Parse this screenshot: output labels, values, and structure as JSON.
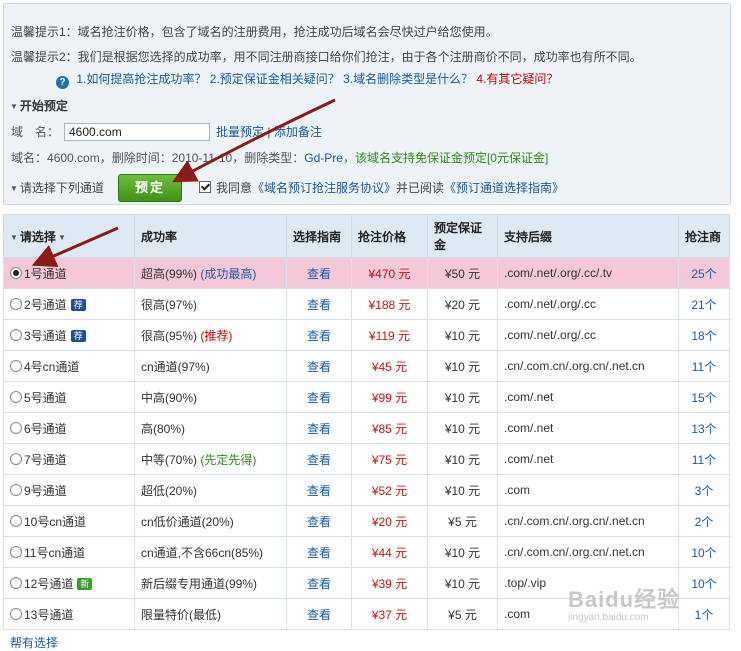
{
  "tips": {
    "tip1": "温馨提示1：域名抢注价格，包含了域名的注册费用，抢注成功后域名会尽快过户给您使用。",
    "tip2": "温馨提示2：我们是根据您选择的成功率，用不同注册商接口给你们抢注，由于各个注册商价不同，成功率也有所不同。"
  },
  "faq": {
    "q1": "1.如何提高抢注成功率？",
    "q2": "2.预定保证金相关疑问？",
    "q3": "3.域名删除类型是什么？",
    "q4": "4.有其它疑问？"
  },
  "booking": {
    "section_title": "开始预定",
    "domain_label": "域　名：",
    "domain_value": "4600.com",
    "batch_link": "批量预定",
    "separator": "|",
    "note_link": "添加备注",
    "info_prefix": "域名：",
    "info_domain": "4600.com",
    "info_delete_label": "，删除时间：",
    "info_delete_time": "2010-11-10",
    "info_type_label": "，删除类型：",
    "info_type": "Gd-Pre",
    "info_free": "，该域名支持免保证金预定[0元保证金]",
    "channel_label": "请选择下列通道",
    "book_button": "预定",
    "agree_prefix": "我同意",
    "agree_link1": "《域名预订抢注服务协议》",
    "agree_mid": "并已阅读",
    "agree_link2": "《预订通道选择指南》"
  },
  "table": {
    "headers": [
      "请选择",
      "成功率",
      "选择指南",
      "抢注价格",
      "预定保证金",
      "支持后缀",
      "抢注商"
    ],
    "rows": [
      {
        "name": "1号通道",
        "badge": "",
        "rate": "超高(99%)",
        "note": "(成功最高)",
        "guide": "查看",
        "price": "¥470 元",
        "deposit": "¥50 元",
        "suffix": ".com/.net/.org/.cc/.tv",
        "count": "25个"
      },
      {
        "name": "2号通道",
        "badge": "荐",
        "rate": "很高(97%)",
        "note": "",
        "guide": "查看",
        "price": "¥188 元",
        "deposit": "¥20 元",
        "suffix": ".com/.net/.org/.cc",
        "count": "21个"
      },
      {
        "name": "3号通道",
        "badge": "荐",
        "rate": "很高(95%)",
        "note": "(推荐)",
        "guide": "查看",
        "price": "¥119 元",
        "deposit": "¥10 元",
        "suffix": ".com/.net/.org/.cc",
        "count": "18个"
      },
      {
        "name": "4号cn通道",
        "badge": "",
        "rate": "cn通道(97%)",
        "note": "",
        "guide": "查看",
        "price": "¥45 元",
        "deposit": "¥10 元",
        "suffix": ".cn/.com.cn/.org.cn/.net.cn",
        "count": "11个"
      },
      {
        "name": "5号通道",
        "badge": "",
        "rate": "中高(90%)",
        "note": "",
        "guide": "查看",
        "price": "¥99 元",
        "deposit": "¥10 元",
        "suffix": ".com/.net",
        "count": "15个"
      },
      {
        "name": "6号通道",
        "badge": "",
        "rate": "高(80%)",
        "note": "",
        "guide": "查看",
        "price": "¥85 元",
        "deposit": "¥10 元",
        "suffix": ".com/.net",
        "count": "13个"
      },
      {
        "name": "7号通道",
        "badge": "",
        "rate": "中等(70%)",
        "note": "(先定先得)",
        "guide": "查看",
        "price": "¥75 元",
        "deposit": "¥10 元",
        "suffix": ".com/.net",
        "count": "11个"
      },
      {
        "name": "9号通道",
        "badge": "",
        "rate": "超低(20%)",
        "note": "",
        "guide": "查看",
        "price": "¥52 元",
        "deposit": "¥10 元",
        "suffix": ".com",
        "count": "3个"
      },
      {
        "name": "10号cn通道",
        "badge": "",
        "rate": "cn低价通道(20%)",
        "note": "",
        "guide": "查看",
        "price": "¥20 元",
        "deposit": "¥5 元",
        "suffix": ".cn/.com.cn/.org.cn/.net.cn",
        "count": "2个"
      },
      {
        "name": "11号cn通道",
        "badge": "",
        "rate": "cn通道,不含66cn(85%)",
        "note": "",
        "guide": "查看",
        "price": "¥44 元",
        "deposit": "¥10 元",
        "suffix": ".cn/.com.cn/.org.cn/.net.cn",
        "count": "10个"
      },
      {
        "name": "12号通道",
        "badge": "新",
        "rate": "新后缀专用通道(99%)",
        "note": "",
        "guide": "查看",
        "price": "¥39 元",
        "deposit": "¥10 元",
        "suffix": ".top/.vip",
        "count": "10个"
      },
      {
        "name": "13号通道",
        "badge": "",
        "rate": "限量特价(最低)",
        "note": "",
        "guide": "查看",
        "price": "¥37 元",
        "deposit": "¥5 元",
        "suffix": ".com",
        "count": "1个"
      }
    ]
  },
  "watermark": {
    "brand": "Baidu经验",
    "url": "jingyan.baidu.com"
  },
  "bottom": {
    "link": "帮有选择"
  },
  "colors": {
    "selected_row": "#f5c8d9",
    "header": "#dde9f3",
    "price": "#d01010",
    "link": "#1a5aa6",
    "button": "#4fa323"
  }
}
